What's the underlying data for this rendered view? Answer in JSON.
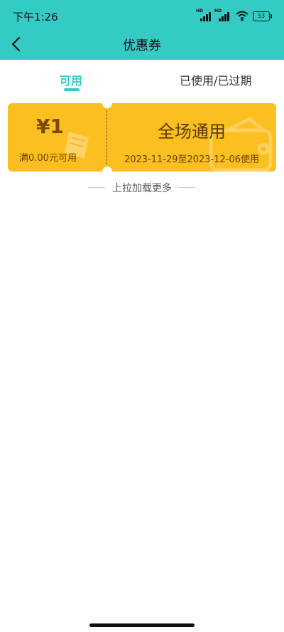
{
  "status_bar": {
    "time": "下午1:26",
    "battery": "53",
    "hd1": "HD",
    "hd2": "HD"
  },
  "nav": {
    "title": "优惠券",
    "back_icon": "chevron-left-icon"
  },
  "tabs": {
    "available": "可用",
    "used_expired": "已使用/已过期",
    "active": "available"
  },
  "coupon": {
    "amount": "¥1",
    "condition": "满0.00元可用",
    "name": "全场通用",
    "validity": "2023-11-29至2023-12-06使用"
  },
  "load_more": "上拉加载更多",
  "colors": {
    "header": "#35cbc5",
    "accent": "#35cbc5",
    "coupon_bg": "#fbbf1f"
  }
}
